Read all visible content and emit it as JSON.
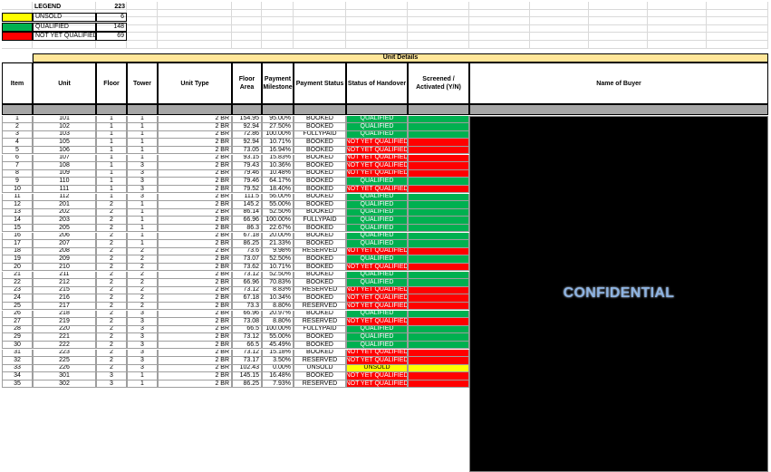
{
  "legend": {
    "title": "LEGEND",
    "total": "223",
    "items": [
      {
        "label": "UNSOLD",
        "count": "6",
        "color": "#ffff00"
      },
      {
        "label": "QUALIFIED",
        "count": "148",
        "color": "#00b050"
      },
      {
        "label": "NOT YET QUALIFIED",
        "count": "69",
        "color": "#ff0000"
      }
    ]
  },
  "banner": "Unit Details",
  "columns": [
    "Item",
    "Unit",
    "Floor",
    "Tower",
    "Unit Type",
    "Floor Area",
    "Payment Milestone",
    "Payment Status",
    "Status of Handover",
    "Screened / Activated (Y/N)",
    "Name of Buyer"
  ],
  "confidential": "CONFIDENTIAL",
  "colors": {
    "qualified": "#00b050",
    "not_qualified": "#ff0000",
    "unsold": "#ffff00",
    "banner": "#ffe699",
    "filter_row": "#a6a6a6"
  },
  "rows": [
    [
      "1",
      "101",
      "1",
      "1",
      "2 BR",
      "154.95",
      "95.00%",
      "BOOKED",
      "QUALIFIED"
    ],
    [
      "2",
      "102",
      "1",
      "1",
      "2 BR",
      "92.94",
      "27.50%",
      "BOOKED",
      "QUALIFIED"
    ],
    [
      "3",
      "103",
      "1",
      "1",
      "2 BR",
      "72.86",
      "100.00%",
      "FULLYPAID",
      "QUALIFIED"
    ],
    [
      "4",
      "105",
      "1",
      "1",
      "2 BR",
      "92.94",
      "10.71%",
      "BOOKED",
      "NOT YET QUALIFIED"
    ],
    [
      "5",
      "106",
      "1",
      "1",
      "2 BR",
      "73.05",
      "16.94%",
      "BOOKED",
      "NOT YET QUALIFIED"
    ],
    [
      "6",
      "107",
      "1",
      "1",
      "2 BR",
      "93.15",
      "15.83%",
      "BOOKED",
      "NOT YET QUALIFIED"
    ],
    [
      "7",
      "108",
      "1",
      "3",
      "2 BR",
      "79.43",
      "10.36%",
      "BOOKED",
      "NOT YET QUALIFIED"
    ],
    [
      "8",
      "109",
      "1",
      "3",
      "2 BR",
      "79.46",
      "10.48%",
      "BOOKED",
      "NOT YET QUALIFIED"
    ],
    [
      "9",
      "110",
      "1",
      "3",
      "2 BR",
      "79.46",
      "64.17%",
      "BOOKED",
      "QUALIFIED"
    ],
    [
      "10",
      "111",
      "1",
      "3",
      "2 BR",
      "79.52",
      "18.40%",
      "BOOKED",
      "NOT YET QUALIFIED"
    ],
    [
      "11",
      "112",
      "1",
      "3",
      "2 BR",
      "111.5",
      "56.00%",
      "BOOKED",
      "QUALIFIED"
    ],
    [
      "12",
      "201",
      "2",
      "1",
      "2 BR",
      "145.2",
      "55.00%",
      "BOOKED",
      "QUALIFIED"
    ],
    [
      "13",
      "202",
      "2",
      "1",
      "2 BR",
      "86.14",
      "52.50%",
      "BOOKED",
      "QUALIFIED"
    ],
    [
      "14",
      "203",
      "2",
      "1",
      "2 BR",
      "66.96",
      "100.00%",
      "FULLYPAID",
      "QUALIFIED"
    ],
    [
      "15",
      "205",
      "2",
      "1",
      "2 BR",
      "86.3",
      "22.67%",
      "BOOKED",
      "QUALIFIED"
    ],
    [
      "16",
      "206",
      "2",
      "1",
      "2 BR",
      "67.18",
      "20.00%",
      "BOOKED",
      "QUALIFIED"
    ],
    [
      "17",
      "207",
      "2",
      "1",
      "2 BR",
      "86.25",
      "21.33%",
      "BOOKED",
      "QUALIFIED"
    ],
    [
      "18",
      "208",
      "2",
      "2",
      "2 BR",
      "73.6",
      "9.98%",
      "RESERVED",
      "NOT YET QUALIFIED"
    ],
    [
      "19",
      "209",
      "2",
      "2",
      "2 BR",
      "73.07",
      "52.50%",
      "BOOKED",
      "QUALIFIED"
    ],
    [
      "20",
      "210",
      "2",
      "2",
      "2 BR",
      "73.62",
      "10.71%",
      "BOOKED",
      "NOT YET QUALIFIED"
    ],
    [
      "21",
      "211",
      "2",
      "2",
      "2 BR",
      "73.12",
      "52.50%",
      "BOOKED",
      "QUALIFIED"
    ],
    [
      "22",
      "212",
      "2",
      "2",
      "2 BR",
      "66.96",
      "70.83%",
      "BOOKED",
      "QUALIFIED"
    ],
    [
      "23",
      "215",
      "2",
      "2",
      "2 BR",
      "73.12",
      "8.83%",
      "RESERVED",
      "NOT YET QUALIFIED"
    ],
    [
      "24",
      "216",
      "2",
      "2",
      "2 BR",
      "67.18",
      "10.34%",
      "BOOKED",
      "NOT YET QUALIFIED"
    ],
    [
      "25",
      "217",
      "2",
      "2",
      "2 BR",
      "73.3",
      "8.80%",
      "RESERVED",
      "NOT YET QUALIFIED"
    ],
    [
      "26",
      "218",
      "2",
      "3",
      "2 BR",
      "66.96",
      "20.97%",
      "BOOKED",
      "QUALIFIED"
    ],
    [
      "27",
      "219",
      "2",
      "3",
      "2 BR",
      "73.08",
      "8.80%",
      "RESERVED",
      "NOT YET QUALIFIED"
    ],
    [
      "28",
      "220",
      "2",
      "3",
      "2 BR",
      "66.5",
      "100.00%",
      "FULLYPAID",
      "QUALIFIED"
    ],
    [
      "29",
      "221",
      "2",
      "3",
      "2 BR",
      "73.12",
      "55.00%",
      "BOOKED",
      "QUALIFIED"
    ],
    [
      "30",
      "222",
      "2",
      "3",
      "2 BR",
      "66.5",
      "45.49%",
      "BOOKED",
      "QUALIFIED"
    ],
    [
      "31",
      "223",
      "2",
      "3",
      "2 BR",
      "73.12",
      "15.18%",
      "BOOKED",
      "NOT YET QUALIFIED"
    ],
    [
      "32",
      "225",
      "2",
      "3",
      "2 BR",
      "73.17",
      "3.50%",
      "RESERVED",
      "NOT YET QUALIFIED"
    ],
    [
      "33",
      "226",
      "2",
      "3",
      "2 BR",
      "102.43",
      "0.00%",
      "UNSOLD",
      "UNSOLD"
    ],
    [
      "34",
      "301",
      "3",
      "1",
      "2 BR",
      "145.15",
      "16.48%",
      "BOOKED",
      "NOT YET QUALIFIED"
    ],
    [
      "35",
      "302",
      "3",
      "1",
      "2 BR",
      "86.25",
      "7.93%",
      "RESERVED",
      "NOT YET QUALIFIED"
    ]
  ]
}
